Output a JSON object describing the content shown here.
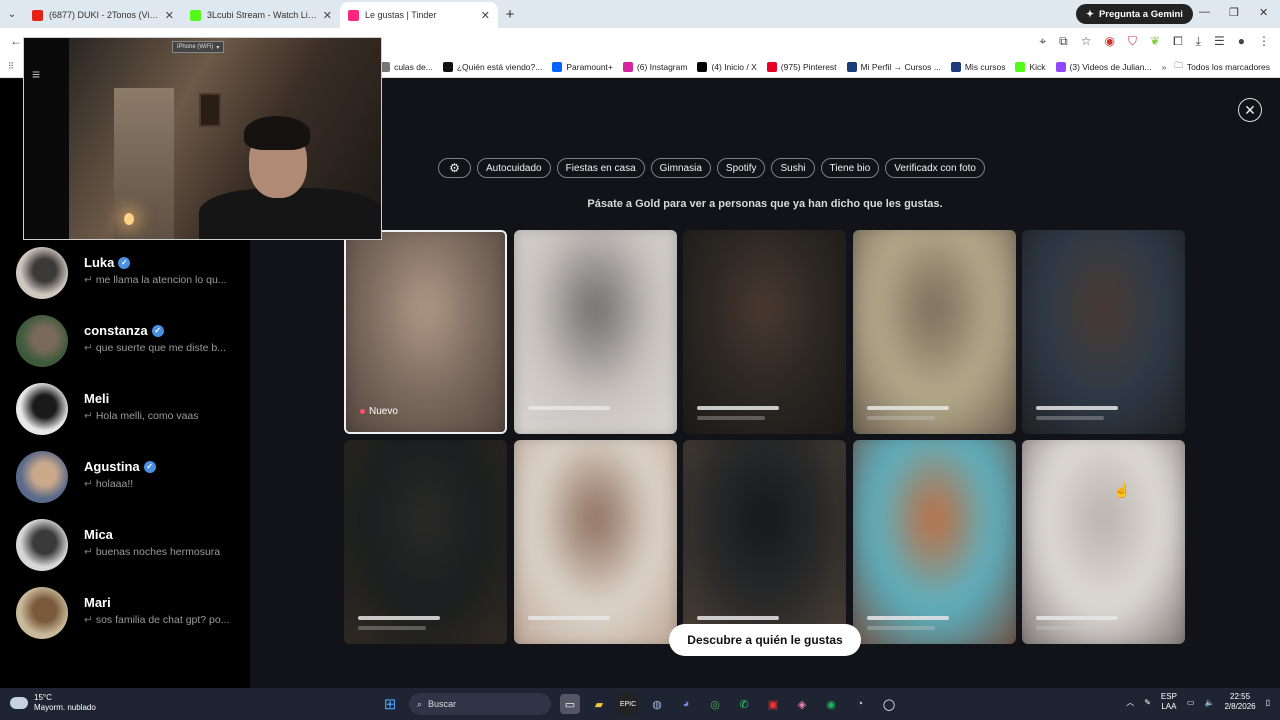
{
  "browser": {
    "tabs": [
      {
        "title": "(6877) DUKI - 2Tonos (Video Of",
        "favicon_color": "#e62117",
        "active": false
      },
      {
        "title": "3Lcubi Stream - Watch Live on K",
        "favicon_color": "#53fc18",
        "active": false
      },
      {
        "title": "Le gustas | Tinder",
        "favicon_color": "#fd267a",
        "active": true
      }
    ],
    "gemini_label": "Pregunta a Gemini",
    "bookmarks": [
      {
        "label": "culas de...",
        "color": "#777"
      },
      {
        "label": "¿Quién está viendo?...",
        "color": "#111"
      },
      {
        "label": "Paramount+",
        "color": "#0064ff"
      },
      {
        "label": "(6) Instagram",
        "color": "#d6249f"
      },
      {
        "label": "(4) Inicio / X",
        "color": "#000"
      },
      {
        "label": "(975) Pinterest",
        "color": "#e60023"
      },
      {
        "label": "Mi Perfil → Cursos ...",
        "color": "#1d3b7a"
      },
      {
        "label": "Mis cursos",
        "color": "#1d3b7a"
      },
      {
        "label": "Kick",
        "color": "#53fc18"
      },
      {
        "label": "(3) Videos de Julian...",
        "color": "#9146ff"
      }
    ],
    "all_bookmarks_label": "Todos los marcadores"
  },
  "webcam": {
    "source_label": "iPhone (WiFi)"
  },
  "sidebar": {
    "chats": [
      {
        "name": "Luka",
        "verified": true,
        "message": "me llama la atencion lo qu...",
        "avatar_colors": [
          "#cfc7c0",
          "#3c3a38"
        ]
      },
      {
        "name": "constanza",
        "verified": true,
        "message": "que suerte que me diste b...",
        "avatar_colors": [
          "#3d5a3a",
          "#7a6a5a"
        ]
      },
      {
        "name": "Meli",
        "verified": false,
        "message": "Hola melli, como vaas",
        "avatar_colors": [
          "#e8e8e8",
          "#1a1a1a"
        ]
      },
      {
        "name": "Agustina",
        "verified": true,
        "message": "holaaa!!",
        "avatar_colors": [
          "#5a6a8a",
          "#caa88a"
        ]
      },
      {
        "name": "Mica",
        "verified": false,
        "message": "buenas noches hermosura",
        "avatar_colors": [
          "#d8d8d8",
          "#3a3a3a"
        ]
      },
      {
        "name": "Mari",
        "verified": false,
        "message": "sos familia de chat gpt? po...",
        "avatar_colors": [
          "#c9b89a",
          "#7a5a3a"
        ]
      }
    ]
  },
  "main": {
    "filters": [
      "Autocuidado",
      "Fiestas en casa",
      "Gimnasia",
      "Spotify",
      "Sushi",
      "Tiene bio",
      "Verificadx con foto"
    ],
    "gold_message": "Pásate a Gold para ver a personas que ya han dicho que les gustas.",
    "new_label": "Nuevo",
    "cta_label": "Descubre a quién le gustas",
    "cards": [
      {
        "colors": [
          "#7a6a5e",
          "#b49a88",
          "#4a3e36"
        ]
      },
      {
        "colors": [
          "#c9c4c0",
          "#6e6a68",
          "#e0dcd8"
        ]
      },
      {
        "colors": [
          "#2a2622",
          "#4a3a30",
          "#1a1614"
        ]
      },
      {
        "colors": [
          "#b7ab8c",
          "#7a6a58",
          "#5a4e42"
        ]
      },
      {
        "colors": [
          "#2e3a48",
          "#4a3a30",
          "#1e1a18"
        ]
      },
      {
        "colors": [
          "#1a1e1e",
          "#2a2a28",
          "#3a2e24"
        ]
      },
      {
        "colors": [
          "#ded6cc",
          "#8a6a58",
          "#b49a88"
        ]
      },
      {
        "colors": [
          "#2a2a2a",
          "#14181c",
          "#5a4a3a"
        ]
      },
      {
        "colors": [
          "#5ab3c4",
          "#c46a3a",
          "#7a3a24"
        ]
      },
      {
        "colors": [
          "#e0dcd8",
          "#b8b0aa",
          "#6a6260"
        ]
      }
    ]
  },
  "taskbar": {
    "temperature": "15°C",
    "weather": "Mayorm. nublado",
    "search_placeholder": "Buscar",
    "language_top": "ESP",
    "language_bottom": "LAA",
    "time": "22:55",
    "date": "2/8/2026"
  }
}
